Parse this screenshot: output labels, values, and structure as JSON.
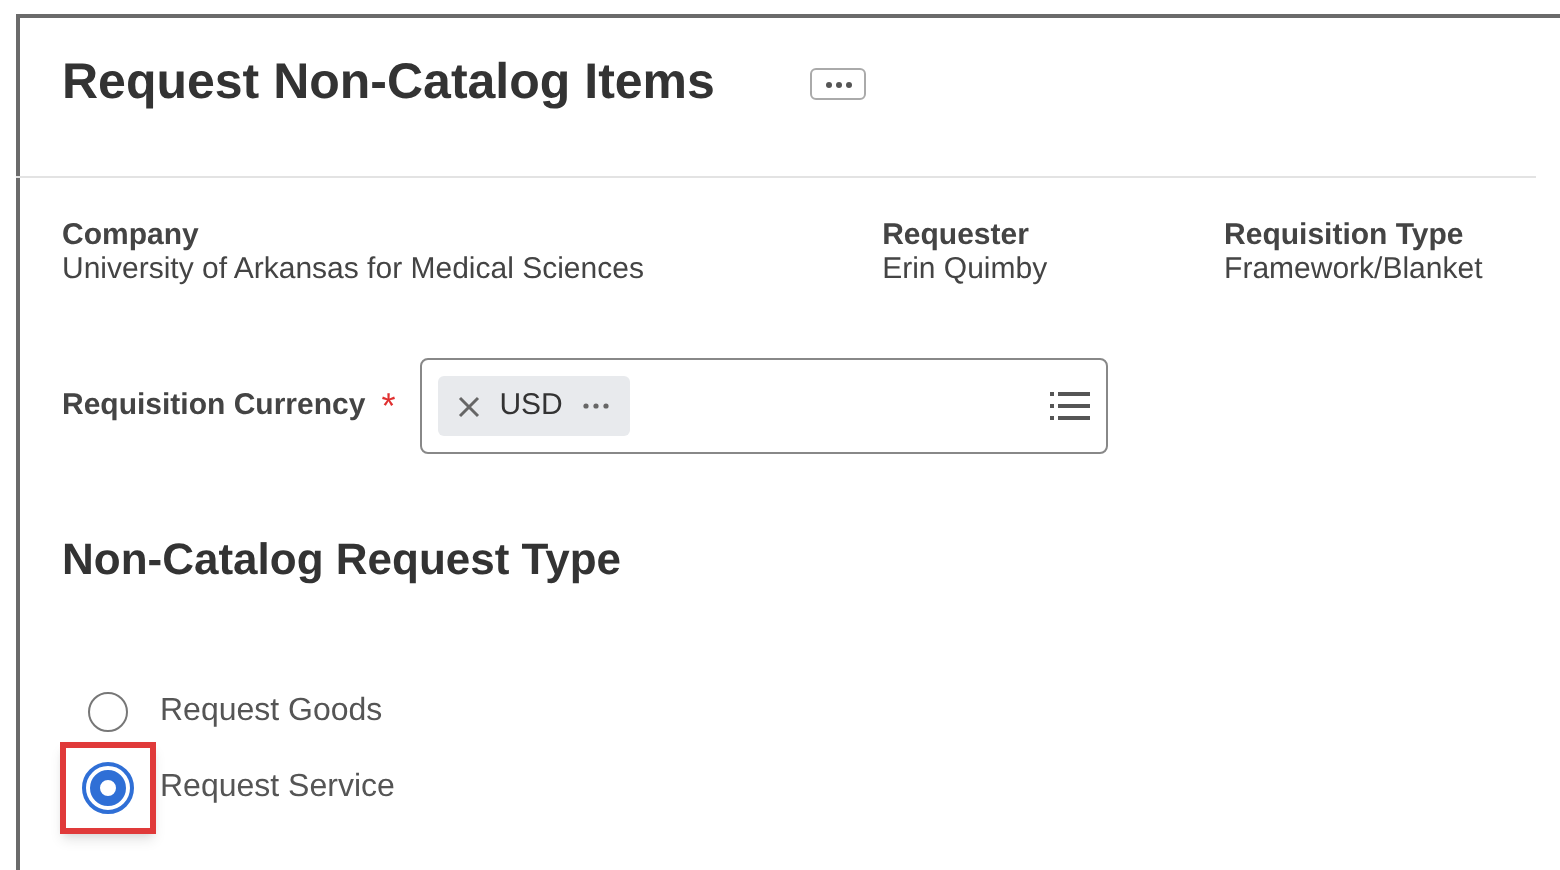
{
  "page": {
    "title": "Request Non-Catalog Items"
  },
  "fields": [
    {
      "label": "Company",
      "value": "University of Arkansas for Medical Sciences"
    },
    {
      "label": "Requester",
      "value": "Erin Quimby"
    },
    {
      "label": "Requisition Type",
      "value": "Framework/Blanket"
    }
  ],
  "currency": {
    "label": "Requisition Currency",
    "required": true,
    "required_mark": "*",
    "tokens": [
      {
        "text": "USD"
      }
    ]
  },
  "request_type": {
    "heading": "Non-Catalog Request Type",
    "options": [
      {
        "label": "Request Goods",
        "selected": false,
        "highlighted": false
      },
      {
        "label": "Request Service",
        "selected": true,
        "highlighted": true
      }
    ]
  }
}
